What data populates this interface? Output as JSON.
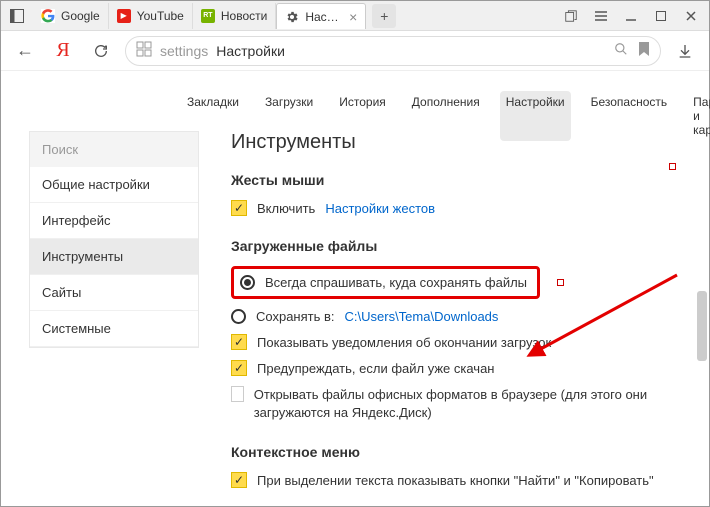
{
  "tabs": [
    {
      "label": "Google"
    },
    {
      "label": "YouTube"
    },
    {
      "label": "Новости"
    },
    {
      "label": "Настройки"
    }
  ],
  "omnibox": {
    "prefix": "settings",
    "title": "Настройки"
  },
  "topnav": [
    {
      "label": "Закладки"
    },
    {
      "label": "Загрузки"
    },
    {
      "label": "История"
    },
    {
      "label": "Дополнения"
    },
    {
      "label": "Настройки",
      "active": true
    },
    {
      "label": "Безопасность"
    },
    {
      "label": "Пароли и карты"
    }
  ],
  "sidebar": {
    "search": "Поиск",
    "items": [
      {
        "label": "Общие настройки"
      },
      {
        "label": "Интерфейс"
      },
      {
        "label": "Инструменты",
        "active": true
      },
      {
        "label": "Сайты"
      },
      {
        "label": "Системные"
      }
    ]
  },
  "page": {
    "heading": "Инструменты",
    "mouse": {
      "title": "Жесты мыши",
      "enable": "Включить",
      "settings": "Настройки жестов"
    },
    "downloads": {
      "title": "Загруженные файлы",
      "ask": "Всегда спрашивать, куда сохранять файлы",
      "save_to": "Сохранять в:",
      "path": "C:\\Users\\Tema\\Downloads",
      "notify": "Показывать уведомления об окончании загрузок",
      "warn": "Предупреждать, если файл уже скачан",
      "open_office": "Открывать файлы офисных форматов в браузере (для этого они загружаются на Яндекс.Диск)"
    },
    "context": {
      "title": "Контекстное меню",
      "selection": "При выделении текста показывать кнопки \"Найти\" и \"Копировать\""
    }
  }
}
